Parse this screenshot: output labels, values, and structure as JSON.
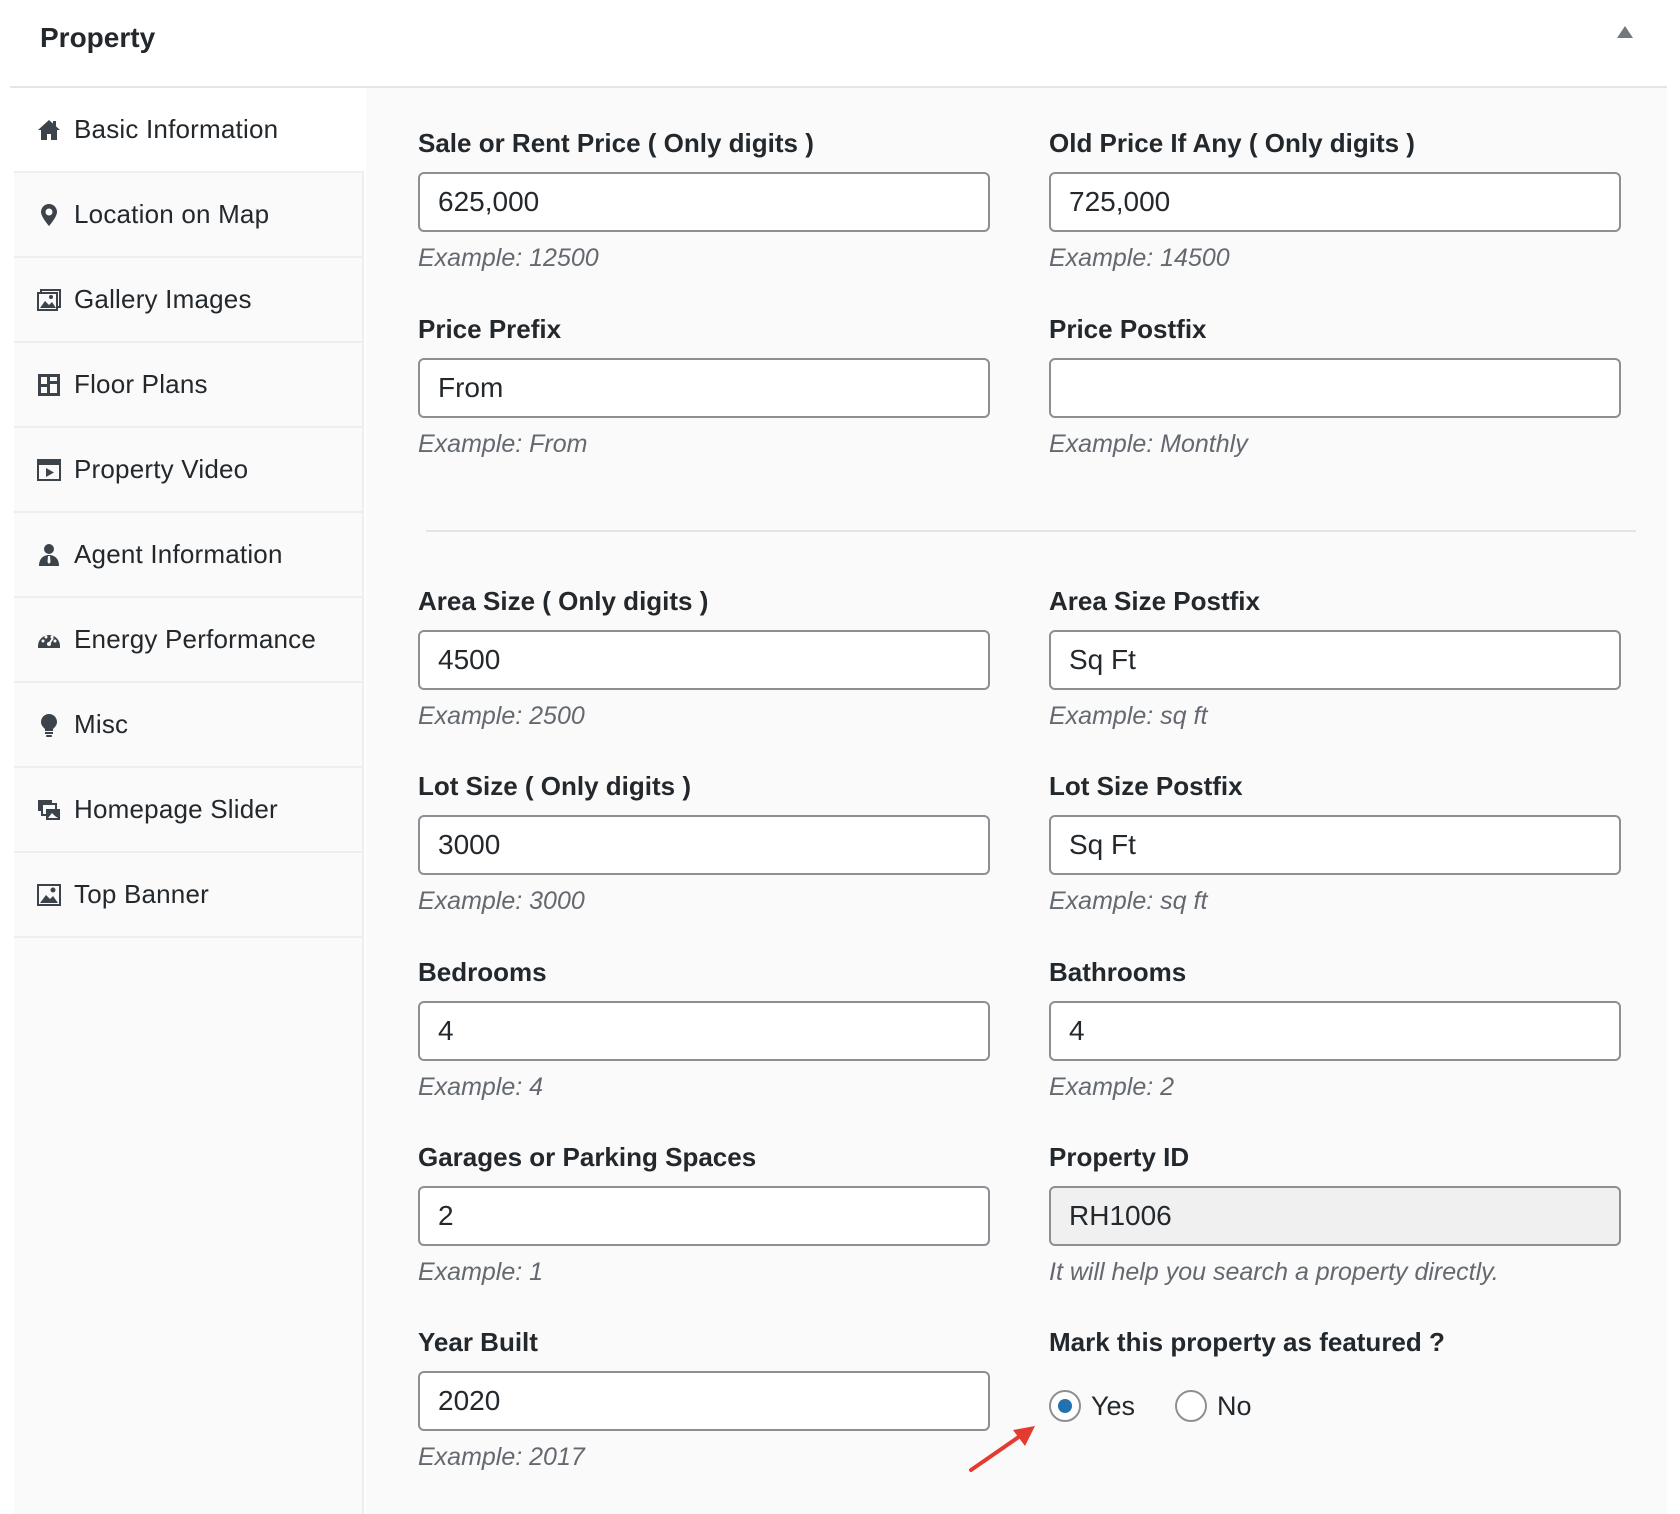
{
  "panel": {
    "title": "Property"
  },
  "tabs": [
    {
      "label": "Basic Information",
      "icon": "home-icon"
    },
    {
      "label": "Location on Map",
      "icon": "map-pin-icon"
    },
    {
      "label": "Gallery Images",
      "icon": "gallery-icon"
    },
    {
      "label": "Floor Plans",
      "icon": "floor-plans-icon"
    },
    {
      "label": "Property Video",
      "icon": "video-icon"
    },
    {
      "label": "Agent Information",
      "icon": "agent-icon"
    },
    {
      "label": "Energy Performance",
      "icon": "gauge-icon"
    },
    {
      "label": "Misc",
      "icon": "lightbulb-icon"
    },
    {
      "label": "Homepage Slider",
      "icon": "slider-icon"
    },
    {
      "label": "Top Banner",
      "icon": "banner-image-icon"
    }
  ],
  "fields": {
    "sale_price": {
      "label": "Sale or Rent Price ( Only digits )",
      "value": "625,000",
      "desc": "Example: 12500"
    },
    "old_price": {
      "label": "Old Price If Any ( Only digits )",
      "value": "725,000",
      "desc": "Example: 14500"
    },
    "price_prefix": {
      "label": "Price Prefix",
      "value": "From",
      "desc": "Example: From"
    },
    "price_postfix": {
      "label": "Price Postfix",
      "value": "",
      "desc": "Example: Monthly"
    },
    "area_size": {
      "label": "Area Size ( Only digits )",
      "value": "4500",
      "desc": "Example: 2500"
    },
    "area_postfix": {
      "label": "Area Size Postfix",
      "value": "Sq Ft",
      "desc": "Example: sq ft"
    },
    "lot_size": {
      "label": "Lot Size ( Only digits )",
      "value": "3000",
      "desc": "Example: 3000"
    },
    "lot_postfix": {
      "label": "Lot Size Postfix",
      "value": "Sq Ft",
      "desc": "Example: sq ft"
    },
    "bedrooms": {
      "label": "Bedrooms",
      "value": "4",
      "desc": "Example: 4"
    },
    "bathrooms": {
      "label": "Bathrooms",
      "value": "4",
      "desc": "Example: 2"
    },
    "garages": {
      "label": "Garages or Parking Spaces",
      "value": "2",
      "desc": "Example: 1"
    },
    "property_id": {
      "label": "Property ID",
      "value": "RH1006",
      "desc": "It will help you search a property directly."
    },
    "year_built": {
      "label": "Year Built",
      "value": "2020",
      "desc": "Example: 2017"
    }
  },
  "featured": {
    "label": "Mark this property as featured ?",
    "options": [
      {
        "label": "Yes",
        "checked": true
      },
      {
        "label": "No",
        "checked": false
      }
    ]
  },
  "colors": {
    "accent": "#2271b1",
    "annotation_arrow": "#e53a2f"
  }
}
